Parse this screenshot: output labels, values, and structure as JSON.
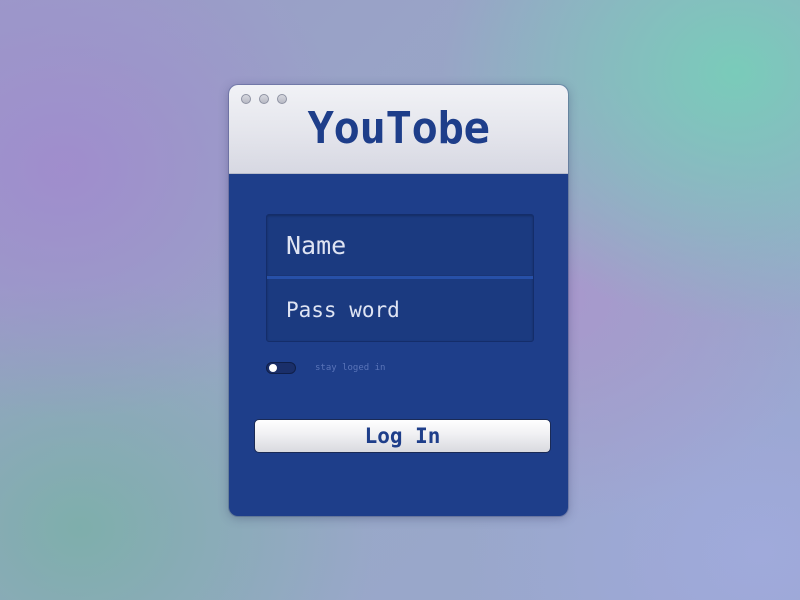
{
  "window": {
    "title": "YouTobe"
  },
  "form": {
    "name_placeholder": "Name",
    "password_placeholder": "Pass word",
    "stay_logged_in_label": "stay loged in",
    "stay_logged_in_on": false,
    "login_label": "Log In"
  },
  "colors": {
    "brand": "#1e3e8a",
    "field_text": "#dfe4f3",
    "titlebar": "#e4e5ec"
  },
  "icons": {
    "window_controls": [
      "window-control-dot-icon",
      "window-control-dot-icon",
      "window-control-dot-icon"
    ]
  }
}
